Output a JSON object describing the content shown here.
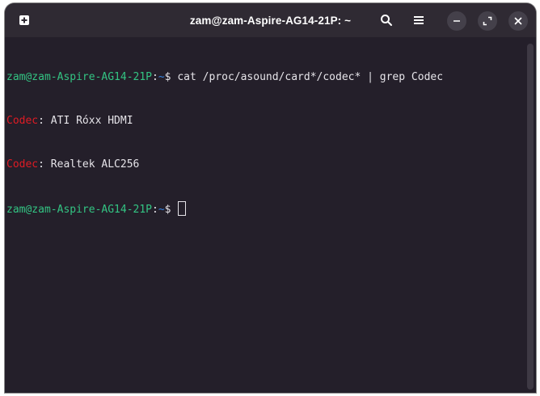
{
  "window": {
    "title": "zam@zam-Aspire-AG14-21P: ~"
  },
  "headerbar": {
    "new_tab_icon": "new-tab-icon",
    "search_icon": "search-icon",
    "menu_icon": "hamburger-menu-icon",
    "minimize_icon": "minimize-icon",
    "maximize_icon": "maximize-icon",
    "close_icon": "close-icon"
  },
  "terminal": {
    "prompt_user_host": "zam@zam-Aspire-AG14-21P",
    "prompt_separator": ":",
    "prompt_path": "~",
    "prompt_symbol": "$ ",
    "command": "cat /proc/asound/card*/codec* | grep Codec",
    "output": [
      {
        "match": "Codec",
        "rest": ": ATI Róxx HDMI"
      },
      {
        "match": "Codec",
        "rest": ": Realtek ALC256"
      }
    ]
  },
  "colors": {
    "background": "#241f2a",
    "headerbar": "#2f2a33",
    "prompt_user": "#33c483",
    "prompt_path": "#3584e4",
    "grep_match": "#e01b24",
    "text": "#e6e4e9"
  }
}
